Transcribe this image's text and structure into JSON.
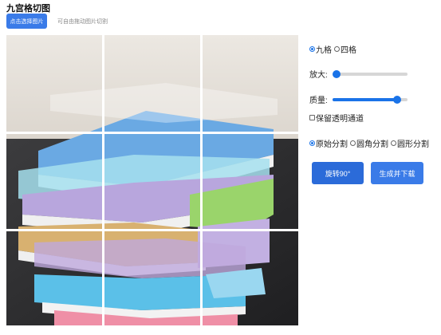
{
  "header": {
    "title": "九宫格切图",
    "upload_label": "点击选择图片",
    "hint": "可自由拖动图片切割"
  },
  "grid": {
    "options": [
      {
        "label": "九格",
        "selected": true
      },
      {
        "label": "四格",
        "selected": false
      }
    ]
  },
  "zoom": {
    "label": "放大:",
    "value": 0.0
  },
  "quality": {
    "label": "质量:",
    "value": 0.86
  },
  "alpha": {
    "label": "保留透明通道",
    "checked": false
  },
  "split_mode": {
    "options": [
      {
        "label": "原始分割",
        "selected": true
      },
      {
        "label": "圆角分割",
        "selected": false
      },
      {
        "label": "圆形分割",
        "selected": false
      }
    ]
  },
  "actions": {
    "rotate_label": "旋转90°",
    "generate_label": "生成并下载"
  },
  "colors": {
    "accent": "#1a73e8",
    "button": "#3a7be8"
  }
}
